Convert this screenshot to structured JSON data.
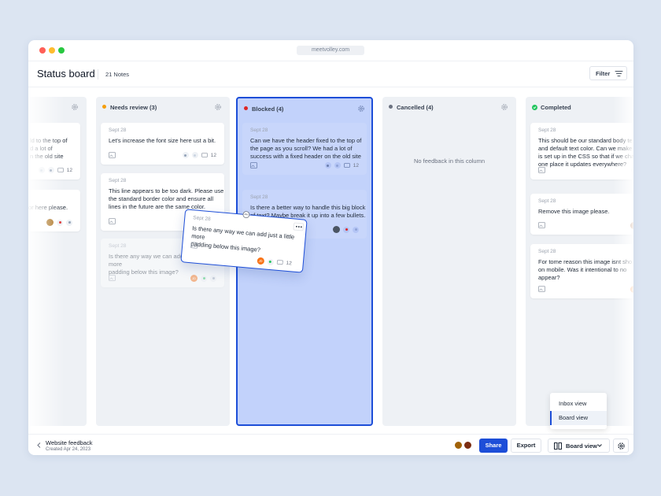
{
  "browser": {
    "url": "meetvolley.com"
  },
  "header": {
    "title": "Status board",
    "note_count": "21 Notes",
    "filter_label": "Filter"
  },
  "columns": {
    "first": {
      "cards": [
        {
          "text": [
            "ld to the top of",
            "d a lot of",
            "n the old site"
          ],
          "count": "12"
        },
        {
          "text": [
            "or here please."
          ]
        }
      ]
    },
    "needs_review": {
      "title": "Needs review (3)",
      "status_color": "#f59e0b",
      "cards": [
        {
          "date": "Sept 28",
          "text": [
            "Let's increase the font size here ust a bit."
          ],
          "count": "12"
        },
        {
          "date": "Sept 28",
          "text": [
            "This line appears to be too dark. Please use",
            "the standard border color and ensure all",
            "lines in the future are the same color."
          ]
        },
        {
          "date": "Sept 28",
          "text": [
            "Is there any way we can add just a little more",
            "padding below this image?"
          ],
          "avatar_initials": "JD"
        }
      ]
    },
    "blocked": {
      "title": "Blocked (4)",
      "status_color": "#dc2626",
      "cards": [
        {
          "date": "Sept 28",
          "text": [
            "Can we have the header fixed to the top of",
            "the page as you scroll? We had a lot of",
            "success with a fixed header on the old site"
          ],
          "count": "12"
        },
        {
          "date": "Sept 28",
          "text": [
            "Is there a better way to handle this big block",
            "of text? Maybe break it up into a few bullets."
          ]
        }
      ]
    },
    "cancelled": {
      "title": "Cancelled (4)",
      "status_color": "#6b7280",
      "empty_message": "No feedback in this column"
    },
    "completed": {
      "title": "Completed",
      "status_color": "#22c55e",
      "cards": [
        {
          "date": "Sept 28",
          "text": [
            "This should be our standard body te",
            "and default text color. Can we make",
            "is set up in the CSS so that if we cha",
            "one place it updates everywhere?"
          ]
        },
        {
          "date": "Sept 28",
          "text": [
            "Remove this image please."
          ]
        },
        {
          "date": "Sept 28",
          "text": [
            "For tome reason this image isnt sho",
            "on mobile. Was it intentional to no",
            "appear?"
          ],
          "avatar_initials": "JD"
        }
      ]
    }
  },
  "dragged_card": {
    "date": "Sept 28",
    "text": [
      "Is there any way we can add just a little more",
      "padding below this image?"
    ],
    "avatar_initials": "JD",
    "count": "12"
  },
  "view_menu": {
    "items": [
      "Inbox view",
      "Board view"
    ],
    "active": "Board view"
  },
  "footer": {
    "site_name": "Website feedback",
    "created": "Created Apr 24, 2023",
    "share_label": "Share",
    "export_label": "Export",
    "view_label": "Board view"
  },
  "colors": {
    "accent": "#1d4ed8",
    "blocked_bg": "#c2d2fb",
    "window_bg": "#dce5f2"
  },
  "icons": [
    "gear-icon",
    "image-icon",
    "comment-icon",
    "filter-icon",
    "board-icon",
    "chevron-down-icon",
    "back-chevron-icon",
    "more-icon",
    "grab-icon"
  ]
}
